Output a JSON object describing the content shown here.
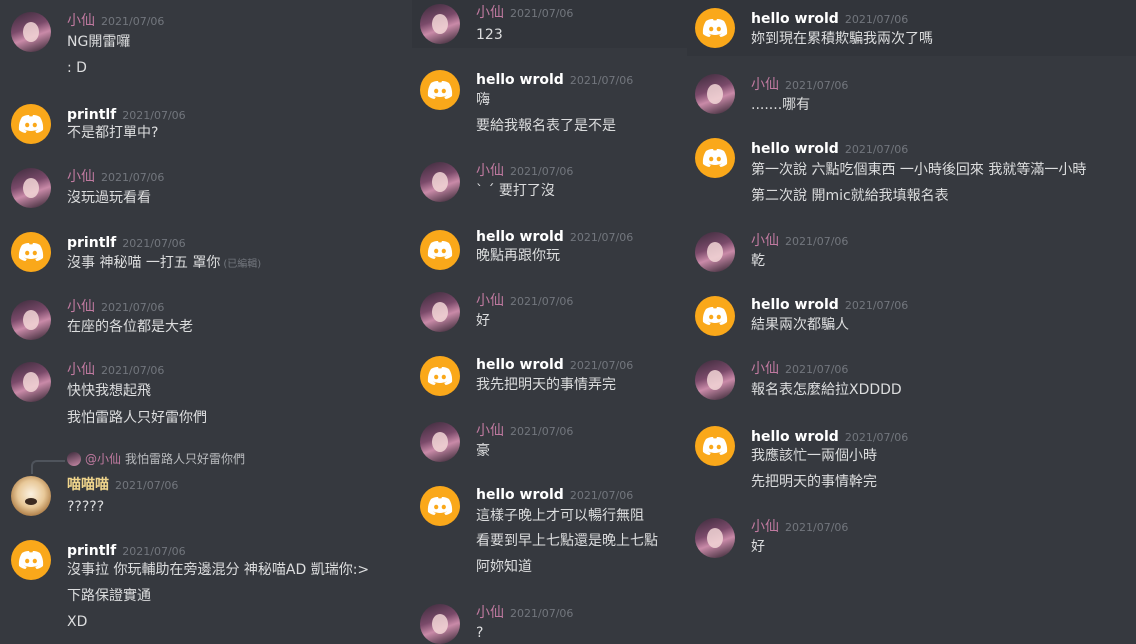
{
  "users": {
    "xian": "小仙",
    "printlf": "printlf",
    "hello": "hello wrold",
    "miao": "喵喵喵"
  },
  "date": "2021/07/06",
  "edited_label": "(已編輯)",
  "col1": [
    {
      "user": "小仙",
      "time": "2021/07/06",
      "lines": [
        "NG開雷囉",
        ": D"
      ]
    },
    {
      "user": "printlf",
      "time": "2021/07/06",
      "lines": [
        "不是都打單中?"
      ]
    },
    {
      "user": "小仙",
      "time": "2021/07/06",
      "lines": [
        "沒玩過玩看看"
      ]
    },
    {
      "user": "printlf",
      "time": "2021/07/06",
      "lines": [
        "沒事 神秘喵 一打五 罩你"
      ]
    },
    {
      "user": "小仙",
      "time": "2021/07/06",
      "lines": [
        "在座的各位都是大老"
      ]
    },
    {
      "user": "小仙",
      "time": "2021/07/06",
      "lines": [
        "快快我想起飛",
        "我怕雷路人只好雷你們"
      ]
    },
    {
      "user": "喵喵喵",
      "time": "2021/07/06",
      "lines": [
        "?????"
      ]
    },
    {
      "user": "printlf",
      "time": "2021/07/06",
      "lines": [
        "沒事拉 你玩輔助在旁邊混分 神秘喵AD 凱瑞你:>",
        "下路保證實通",
        "XD"
      ]
    }
  ],
  "reply": {
    "mention": "@小仙",
    "text": "我怕雷路人只好雷你們"
  },
  "col2": [
    {
      "user": "小仙",
      "time": "2021/07/06",
      "lines": [
        "123"
      ]
    },
    {
      "user": "hello wrold",
      "time": "2021/07/06",
      "lines": [
        "嗨",
        "要給我報名表了是不是"
      ]
    },
    {
      "user": "小仙",
      "time": "2021/07/06",
      "lines": [
        "` ´ 要打了沒"
      ]
    },
    {
      "user": "hello wrold",
      "time": "2021/07/06",
      "lines": [
        "晚點再跟你玩"
      ]
    },
    {
      "user": "小仙",
      "time": "2021/07/06",
      "lines": [
        "好"
      ]
    },
    {
      "user": "hello wrold",
      "time": "2021/07/06",
      "lines": [
        "我先把明天的事情弄完"
      ]
    },
    {
      "user": "小仙",
      "time": "2021/07/06",
      "lines": [
        "豪"
      ]
    },
    {
      "user": "hello wrold",
      "time": "2021/07/06",
      "lines": [
        "這樣子晚上才可以暢行無阻",
        "看要到早上七點還是晚上七點",
        "阿妳知道"
      ]
    },
    {
      "user": "小仙",
      "time": "2021/07/06",
      "lines": [
        "?"
      ]
    }
  ],
  "col3": [
    {
      "user": "hello wrold",
      "time": "2021/07/06",
      "lines": [
        "妳到現在累積欺騙我兩次了嗎"
      ]
    },
    {
      "user": "小仙",
      "time": "2021/07/06",
      "lines": [
        ".......哪有"
      ]
    },
    {
      "user": "hello wrold",
      "time": "2021/07/06",
      "lines": [
        "第一次說 六點吃個東西 一小時後回來 我就等滿一小時",
        "第二次說 開mic就給我填報名表"
      ]
    },
    {
      "user": "小仙",
      "time": "2021/07/06",
      "lines": [
        "乾"
      ]
    },
    {
      "user": "hello wrold",
      "time": "2021/07/06",
      "lines": [
        "結果兩次都騙人"
      ]
    },
    {
      "user": "小仙",
      "time": "2021/07/06",
      "lines": [
        "報名表怎麼給拉XDDDD"
      ]
    },
    {
      "user": "hello wrold",
      "time": "2021/07/06",
      "lines": [
        "我應該忙一兩個小時",
        "先把明天的事情幹完"
      ]
    },
    {
      "user": "小仙",
      "time": "2021/07/06",
      "lines": [
        "好"
      ]
    }
  ]
}
